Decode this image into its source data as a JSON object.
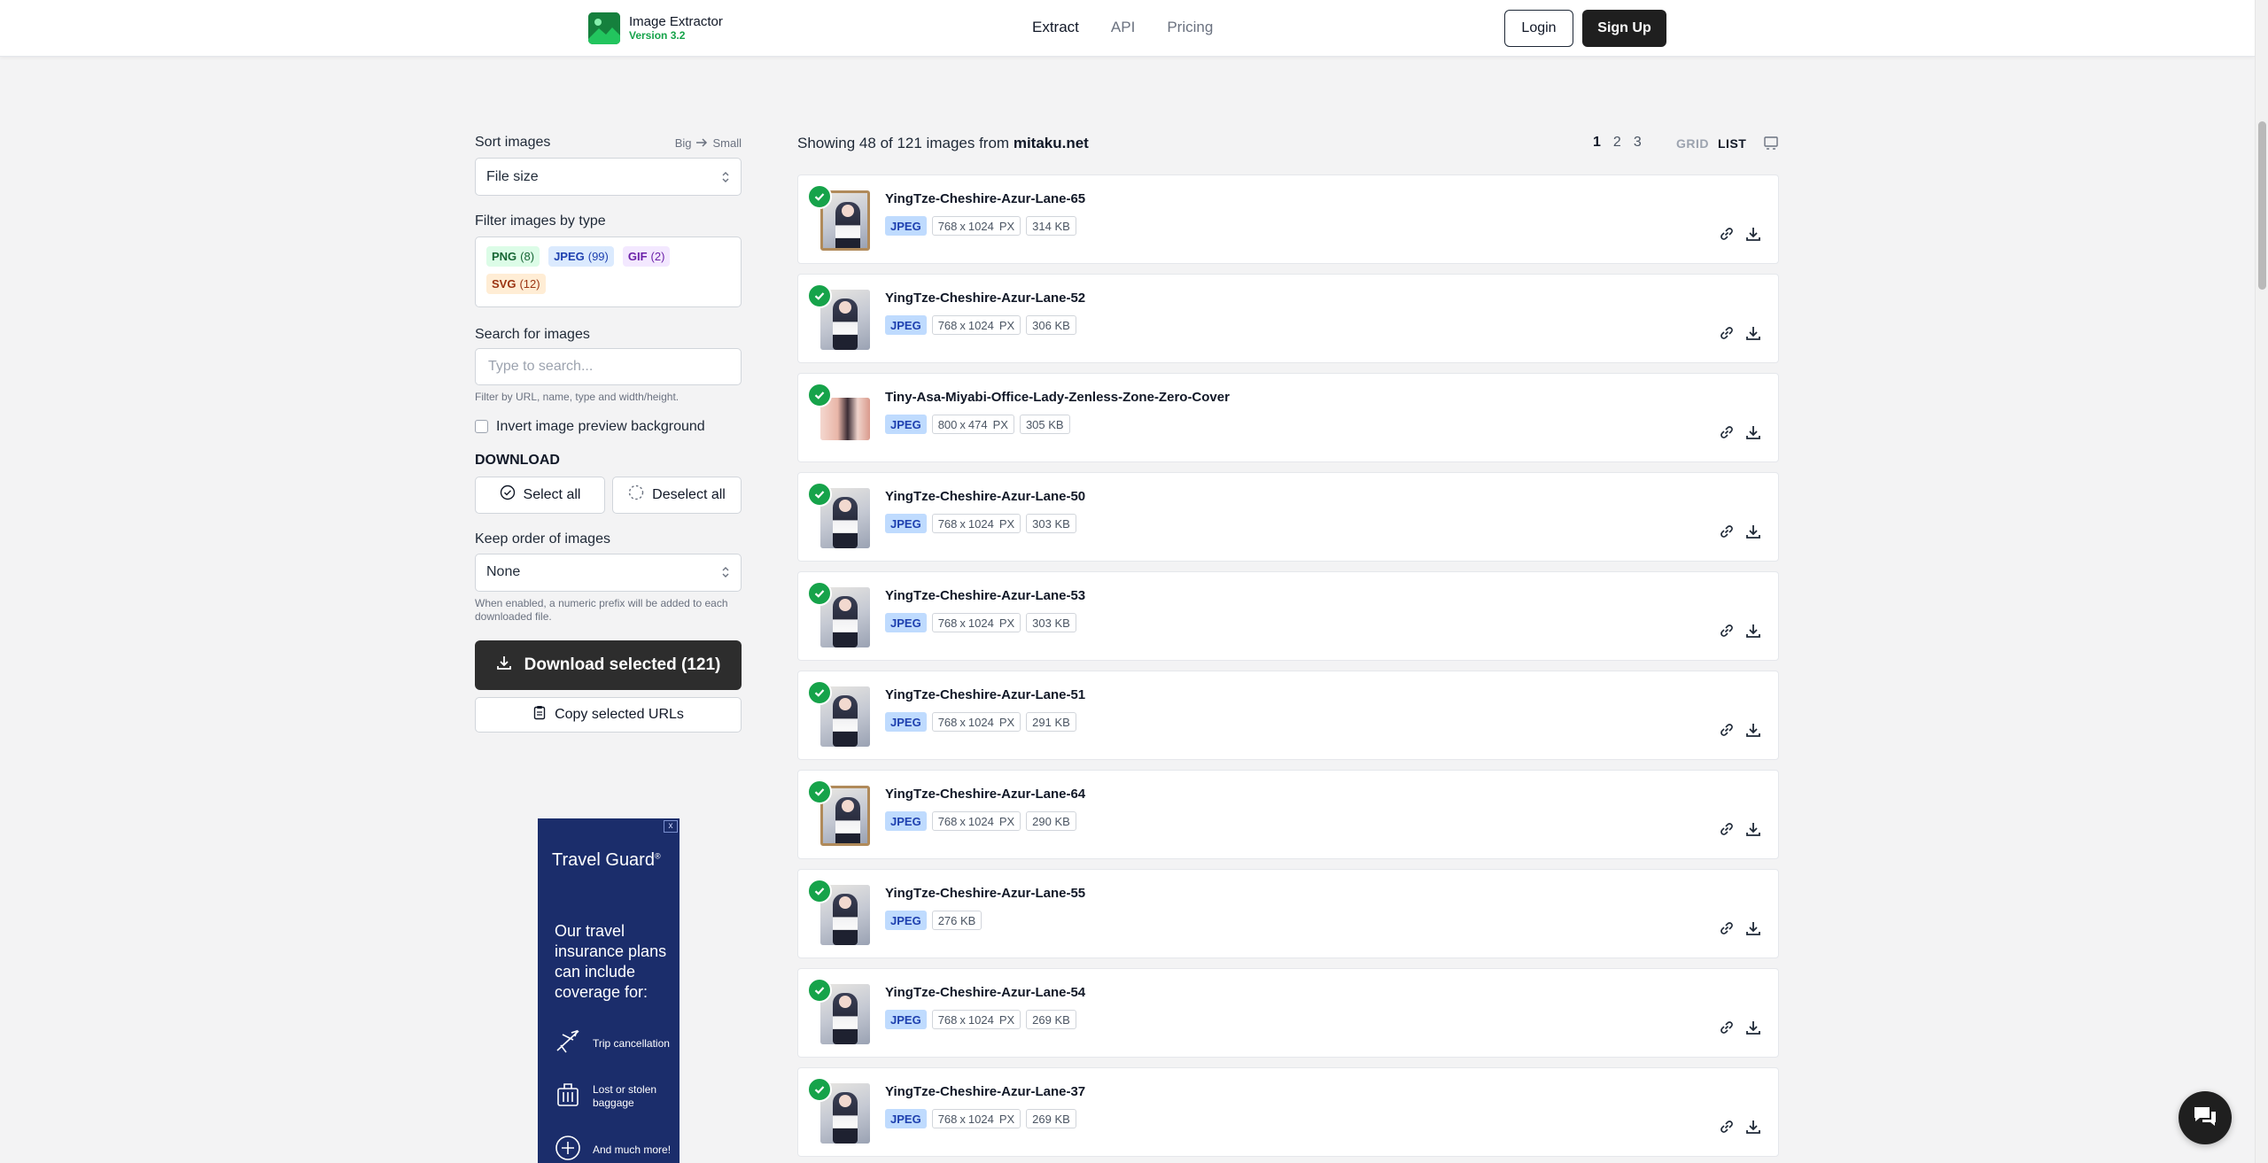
{
  "header": {
    "app_name": "Image Extractor",
    "version": "Version 3.2",
    "nav": [
      {
        "label": "Extract",
        "active": true
      },
      {
        "label": "API",
        "active": false
      },
      {
        "label": "Pricing",
        "active": false
      }
    ],
    "login_label": "Login",
    "signup_label": "Sign Up"
  },
  "sidebar": {
    "sort_label": "Sort images",
    "sort_hint_from": "Big",
    "sort_hint_to": "Small",
    "sort_value": "File size",
    "filter_label": "Filter images by type",
    "filters": [
      {
        "type": "PNG",
        "count": "(8)"
      },
      {
        "type": "JPEG",
        "count": "(99)"
      },
      {
        "type": "GIF",
        "count": "(2)"
      },
      {
        "type": "SVG",
        "count": "(12)"
      }
    ],
    "search_label": "Search for images",
    "search_placeholder": "Type to search...",
    "search_hint": "Filter by URL, name, type and width/height.",
    "invert_label": "Invert image preview background",
    "download_heading": "DOWNLOAD",
    "select_all_label": "Select all",
    "deselect_all_label": "Deselect all",
    "order_label": "Keep order of images",
    "order_value": "None",
    "order_hint": "When enabled, a numeric prefix will be added to each downloaded file.",
    "download_selected_label": "Download selected (121)",
    "copy_urls_label": "Copy selected URLs"
  },
  "ad": {
    "close": "x",
    "brand": "Travel Guard",
    "brand_mark": "®",
    "copy": "Our travel insurance plans can include coverage for:",
    "items": [
      "Trip cancellation",
      "Lost or stolen baggage",
      "And much more!"
    ]
  },
  "main": {
    "showing_prefix": "Showing 48 of 121 images from",
    "domain": "mitaku.net",
    "pages": [
      "1",
      "2",
      "3"
    ],
    "current_page": "1",
    "view_grid": "GRID",
    "view_list": "LIST"
  },
  "images": [
    {
      "name": "YingTze-Cheshire-Azur-Lane-65",
      "type": "JPEG",
      "w": "768",
      "h": "1024",
      "unit": "PX",
      "size": "314 KB",
      "thumb": "frame"
    },
    {
      "name": "YingTze-Cheshire-Azur-Lane-52",
      "type": "JPEG",
      "w": "768",
      "h": "1024",
      "unit": "PX",
      "size": "306 KB",
      "thumb": "portrait"
    },
    {
      "name": "Tiny-Asa-Miyabi-Office-Lady-Zenless-Zone-Zero-Cover",
      "type": "JPEG",
      "w": "800",
      "h": "474",
      "unit": "PX",
      "size": "305 KB",
      "thumb": "wide"
    },
    {
      "name": "YingTze-Cheshire-Azur-Lane-50",
      "type": "JPEG",
      "w": "768",
      "h": "1024",
      "unit": "PX",
      "size": "303 KB",
      "thumb": "portrait"
    },
    {
      "name": "YingTze-Cheshire-Azur-Lane-53",
      "type": "JPEG",
      "w": "768",
      "h": "1024",
      "unit": "PX",
      "size": "303 KB",
      "thumb": "portrait"
    },
    {
      "name": "YingTze-Cheshire-Azur-Lane-51",
      "type": "JPEG",
      "w": "768",
      "h": "1024",
      "unit": "PX",
      "size": "291 KB",
      "thumb": "portrait"
    },
    {
      "name": "YingTze-Cheshire-Azur-Lane-64",
      "type": "JPEG",
      "w": "768",
      "h": "1024",
      "unit": "PX",
      "size": "290 KB",
      "thumb": "frame"
    },
    {
      "name": "YingTze-Cheshire-Azur-Lane-55",
      "type": "JPEG",
      "w": "",
      "h": "",
      "unit": "",
      "size": "276 KB",
      "thumb": "portrait"
    },
    {
      "name": "YingTze-Cheshire-Azur-Lane-54",
      "type": "JPEG",
      "w": "768",
      "h": "1024",
      "unit": "PX",
      "size": "269 KB",
      "thumb": "portrait"
    },
    {
      "name": "YingTze-Cheshire-Azur-Lane-37",
      "type": "JPEG",
      "w": "768",
      "h": "1024",
      "unit": "PX",
      "size": "269 KB",
      "thumb": "portrait"
    }
  ],
  "icons": {
    "logo": "image-icon",
    "sort_arrow": "arrow-right-icon",
    "select_chevron": "chevron-updown-icon",
    "check": "check-circle-icon",
    "link": "link-icon",
    "download": "download-icon",
    "copy": "clipboard-icon",
    "chat": "chat-icon"
  },
  "colors": {
    "accent_green": "#16a34a",
    "primary_dark": "#2d2d2d",
    "jpeg_badge": "#bfdbfe"
  }
}
